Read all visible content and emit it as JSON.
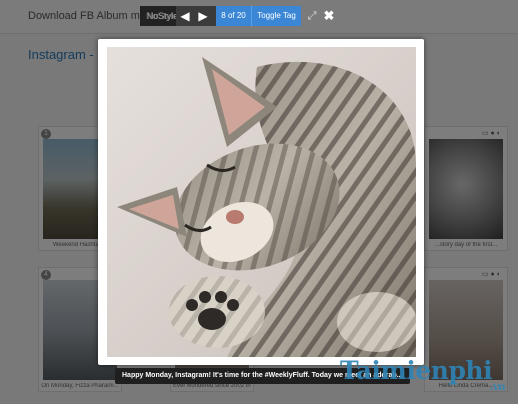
{
  "app": {
    "title": "Download FB Album mod",
    "heading": "Instagram - in"
  },
  "toolbar": {
    "nostyle_label": "NoStyle",
    "prev_icon": "◀",
    "play_icon": "▶",
    "counter": "8 of 20",
    "toggle_label": "Toggle Tag",
    "expand_icon": "⤢",
    "close_icon": "✖"
  },
  "cards": [
    {
      "badge": "1",
      "caption": "Weekend Hashtag..."
    },
    {
      "badge": "",
      "caption": "...story day of the first..."
    },
    {
      "badge": "4",
      "caption": "On Monday, Fizza Pharami..."
    },
    {
      "badge": "",
      "caption": "Ever wondered since 2002 the..."
    },
    {
      "badge": "",
      "caption": "Hello Linda Crema..."
    }
  ],
  "lightbox": {
    "caption": "Happy Monday, Instagram! It's time for the #WeeklyFluff. Today we meet an adorab..."
  },
  "watermark": {
    "text": "Taimienphi",
    "suffix": ".vn"
  },
  "colors": {
    "accent": "#3b87d6",
    "link": "#2a79b8",
    "watermark": "#2f84b6"
  }
}
